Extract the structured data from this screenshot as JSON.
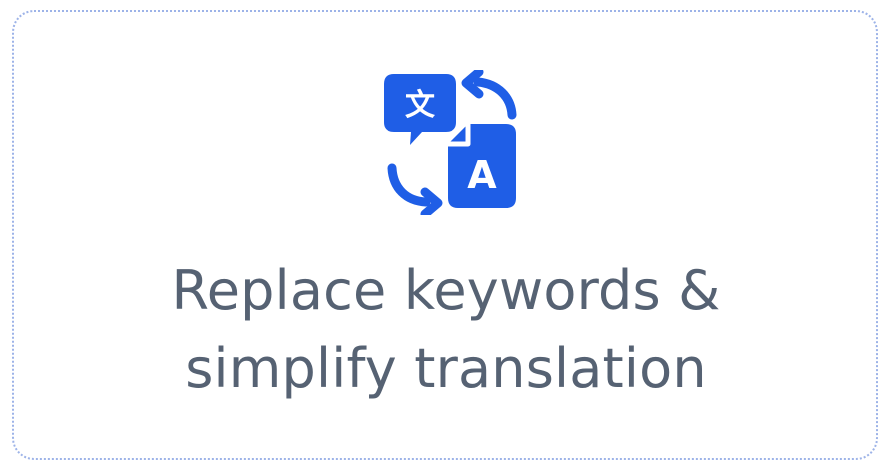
{
  "card": {
    "icon_name": "translate-icon",
    "accent_color": "#1f5ee6",
    "text_color": "#566273",
    "title_line1": "Replace keywords &",
    "title_line2": "simplify translation",
    "icon_glyph_source": "文",
    "icon_glyph_target": "A"
  }
}
